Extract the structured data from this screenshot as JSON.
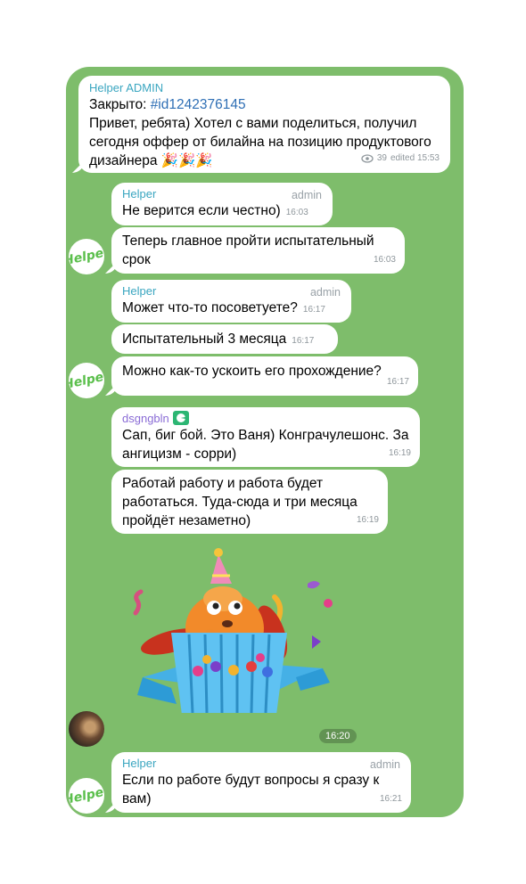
{
  "messages": {
    "m1": {
      "sender": "Helper ADMIN",
      "line1_prefix": "Закрыто: ",
      "line1_link": "#id1242376145",
      "text": "Привет, ребята) Хотел с вами поделиться, получил сегодня оффер от билайна на позицию продуктового дизайнера",
      "emoji": "🎉🎉🎉",
      "views": "39",
      "edited": "edited 15:53"
    },
    "m2": {
      "sender": "Helper",
      "role": "admin",
      "text": "Не верится если честно)",
      "time": "16:03"
    },
    "m3": {
      "text": "Теперь главное пройти испытательный срок",
      "time": "16:03"
    },
    "m4": {
      "sender": "Helper",
      "role": "admin",
      "text": "Может что-то посоветуете?",
      "time": "16:17"
    },
    "m5": {
      "text": "Испытательный 3 месяца",
      "time": "16:17"
    },
    "m6": {
      "text": "Можно как-то ускоить его прохождение?",
      "time": "16:17"
    },
    "m7": {
      "sender": "dsgngbln",
      "text": "Сап, биг бой. Это Ваня) Конграчулешонс. За ангицизм - сорри)",
      "time": "16:19"
    },
    "m8": {
      "text": "Работай работу и работа будет работаться. Туда-сюда и три месяца пройдёт незаметно)",
      "time": "16:19"
    },
    "sticker": {
      "time": "16:20"
    },
    "m9": {
      "sender": "Helper",
      "role": "admin",
      "text": "Если по работе будут вопросы я сразу к вам)",
      "time": "16:21"
    }
  },
  "avatar": {
    "helper_logo": "Helper"
  },
  "colors": {
    "background": "#7ebd6b",
    "bubble": "#ffffff",
    "sender_name": "#3aa6c0",
    "link": "#2f6fb5"
  }
}
